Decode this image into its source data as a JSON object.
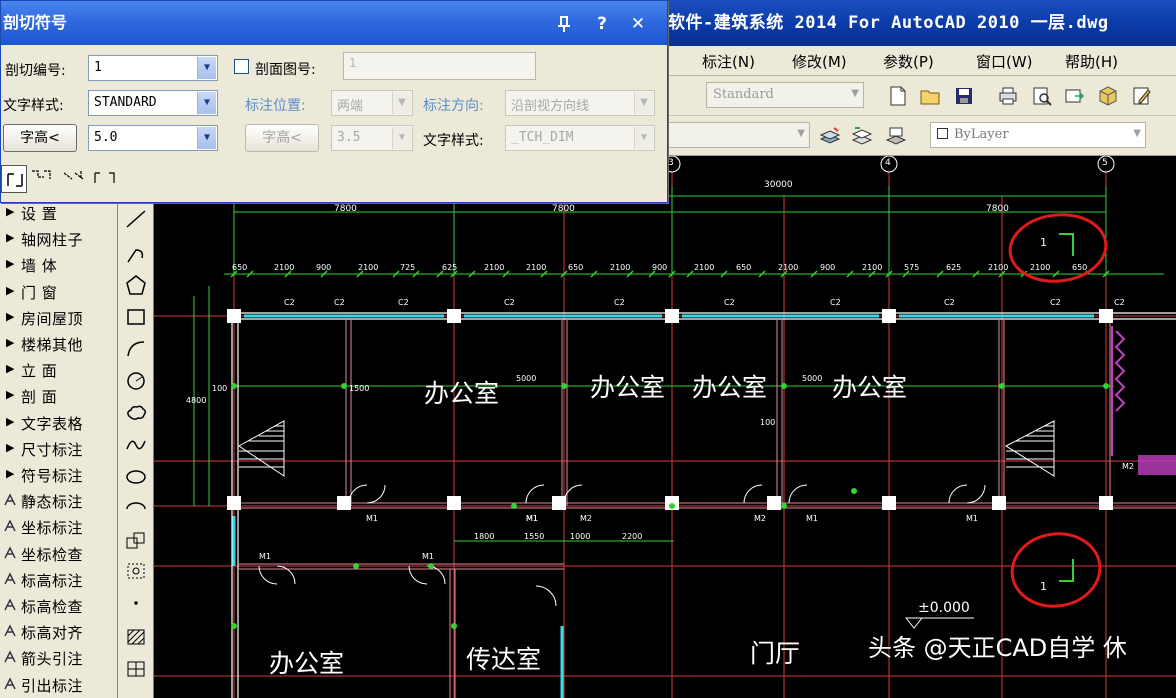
{
  "app": {
    "title": "软件-建筑系统 2014  For AutoCAD 2010  一层.dwg"
  },
  "menu": {
    "items": [
      "标注(N)",
      "修改(M)",
      "参数(P)",
      "窗口(W)",
      "帮助(H)"
    ]
  },
  "toolbar": {
    "text_style": "Standard",
    "layer": "ByLayer"
  },
  "dialog": {
    "title": "剖切符号",
    "section_number_label": "剖切编号:",
    "section_number_value": "1",
    "section_view_checkbox_label": "剖面图号:",
    "section_view_value": "1",
    "text_style_label": "文字样式:",
    "text_style_value": "STANDARD",
    "label_position_label": "标注位置:",
    "label_position_value": "两端",
    "label_direction_label": "标注方向:",
    "label_direction_value": "沿剖视方向线",
    "char_height_button": "字高<",
    "char_height_value": "5.0",
    "char_height_button_2": "字高<",
    "char_height_value_2": "3.5",
    "text_style_label_2": "文字样式:",
    "text_style_value_2": "_TCH_DIM"
  },
  "left_menu": {
    "items": [
      "设    置",
      "轴网柱子",
      "墙    体",
      "门    窗",
      "房间屋顶",
      "楼梯其他",
      "立    面",
      "剖    面",
      "文字表格",
      "尺寸标注",
      "符号标注",
      "静态标注",
      "坐标标注",
      "坐标检查",
      "标高标注",
      "标高检查",
      "标高对齐",
      "箭头引注",
      "引出标注"
    ]
  },
  "drawing": {
    "rooms": [
      "办公室",
      "办公室",
      "办公室",
      "办公室",
      "办公室",
      "传达室",
      "门厅"
    ],
    "total_dim": "30000",
    "bay_dims": [
      "7800",
      "7800",
      "7800"
    ],
    "elevation": "±0.000",
    "section_mark_top": "1",
    "section_mark_bottom": "1",
    "axis_labels": [
      "3",
      "4",
      "5"
    ],
    "sub_dims": [
      "650",
      "2100",
      "900",
      "2100",
      "725",
      "625",
      "2100",
      "2100",
      "650",
      "2100",
      "900",
      "2100",
      "650",
      "2100",
      "900",
      "2100",
      "575",
      "625",
      "2100",
      "2100",
      "650"
    ],
    "window_tags": [
      "C2",
      "C2",
      "C2",
      "C2",
      "C2",
      "C2",
      "C2",
      "C2",
      "C2",
      "C2"
    ],
    "door_tags": [
      "M1",
      "M1",
      "M1",
      "M2",
      "M2",
      "M1",
      "M1",
      "M1",
      "M1",
      "M2"
    ],
    "misc_dims": [
      "1800",
      "1550",
      "1000",
      "2200",
      "5000",
      "5000",
      "100",
      "100",
      "4800",
      "1500"
    ]
  },
  "watermark": {
    "text": "头条 @天正CAD自学 休"
  },
  "colors": {
    "title_bar": "#0a3aa8",
    "dialog_title": "#2f6ae0",
    "chrome": "#ece9d8",
    "wall_red": "#d23a3a",
    "wall_white": "#ffffff",
    "dim_green": "#35d235",
    "highlight_circle": "#e01a1a",
    "column_white": "#ffffff",
    "stair_magenta": "#c040c0"
  }
}
